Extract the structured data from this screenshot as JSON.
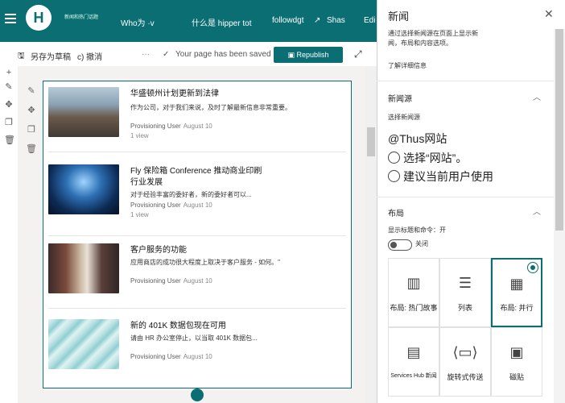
{
  "header": {
    "site_name": "新闻和热门话题",
    "nav": [
      "Who为 ·v",
      "什么是 hipper tot",
      "followdgt",
      "Shas",
      "Edit"
    ]
  },
  "commandbar": {
    "save_draft": "另存为草稿",
    "undo": "c) 撤消",
    "more": "···",
    "status": "Your page has been saved",
    "republish": "Republish"
  },
  "news": [
    {
      "title": "华盛顿州计划更新到法律",
      "desc": "作为公司，对于我们来说，及时了解最新信息非常重要。",
      "author": "Provisioning User",
      "date": "August 10",
      "views": "1 view"
    },
    {
      "title": "Fly 保险箱 Conference 推动商业印刷行业发展",
      "desc": "对于经验丰富的委好者，新的委好者可以...",
      "author": "Provisioning User",
      "date": "August 10",
      "views": "1 view"
    },
    {
      "title": "客户服务的功能",
      "desc": "应用商店的成功很大程度上取决于客户服务 - 如何。\"",
      "author": "Provisioning User",
      "date": "August 10",
      "views": ""
    },
    {
      "title": "新的 401K 数据包现在可用",
      "desc": "请由 HR 办公室停止，以当取 401K 数据包...",
      "author": "Provisioning User",
      "date": "August 10",
      "views": ""
    }
  ],
  "panel": {
    "title": "新闻",
    "intro": "通过选择新闻源在页面上显示新闻，布局和内容选项。",
    "learn_more": "了解详细信息",
    "source_section": "新闻源",
    "select_source": "选择新闻源",
    "current_site": "@Thus网站",
    "option_sites": "选择“网站”。",
    "option_recommend": "建议当前用户使用",
    "layout_section": "布局",
    "show_title": "显示标题和命令：开",
    "toggle_label": "关闭",
    "layouts": [
      "布局: 热门故事",
      "列表",
      "布局: 并行",
      "Services Hub 新闻",
      "旋转式传送",
      "磁贴"
    ]
  },
  "colors": {
    "brand": "#0a6e73"
  }
}
